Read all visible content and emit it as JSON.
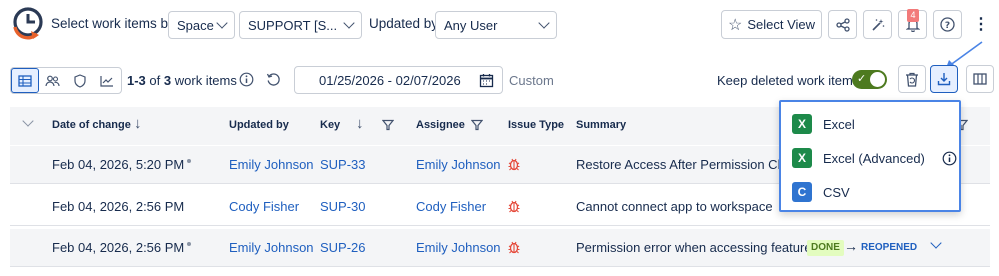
{
  "toolbar": {
    "select_by_label": "Select work items by:",
    "space_value": "Space",
    "project_value": "SUPPORT [S...",
    "updated_by_label": "Updated by:",
    "user_value": "Any User",
    "select_view_label": "Select View",
    "notification_count": "4"
  },
  "second_bar": {
    "count_prefix": "1-3",
    "count_of": "of",
    "count_total": "3",
    "count_suffix": "work items",
    "date_range": "01/25/2026 - 02/07/2026",
    "custom_label": "Custom",
    "keep_deleted_label": "Keep deleted work items"
  },
  "table": {
    "headers": {
      "date": "Date of change",
      "updated_by": "Updated by",
      "key": "Key",
      "assignee": "Assignee",
      "issue_type": "Issue Type",
      "summary": "Summary"
    },
    "rows": [
      {
        "date": "Feb 04, 2026, 5:20 PM",
        "updated_by": "Emily Johnson",
        "key": "SUP-33",
        "assignee": "Emily Johnson",
        "summary": "Restore Access After Permission Char"
      },
      {
        "date": "Feb 04, 2026, 2:56 PM",
        "updated_by": "Cody Fisher",
        "key": "SUP-30",
        "assignee": "Cody Fisher",
        "summary": "Cannot connect app to workspace"
      },
      {
        "date": "Feb 04, 2026, 2:56 PM",
        "updated_by": "Emily Johnson",
        "key": "SUP-26",
        "assignee": "Emily Johnson",
        "summary": "Permission error when accessing feature",
        "status_from": "DONE",
        "status_to": "REOPENED"
      }
    ]
  },
  "export_menu": {
    "items": [
      {
        "label": "Excel",
        "icon": "excel-icon"
      },
      {
        "label": "Excel (Advanced)",
        "icon": "excel-icon"
      },
      {
        "label": "CSV",
        "icon": "csv-icon"
      }
    ]
  },
  "colors": {
    "accent": "#1f5fbf",
    "toggle_on": "#4d7a1f",
    "bug": "#e5493a",
    "menu_border": "#4a84e6",
    "excel": "#1d8a4a",
    "csv": "#2f74d0",
    "done_badge": "#e3fcbf"
  }
}
